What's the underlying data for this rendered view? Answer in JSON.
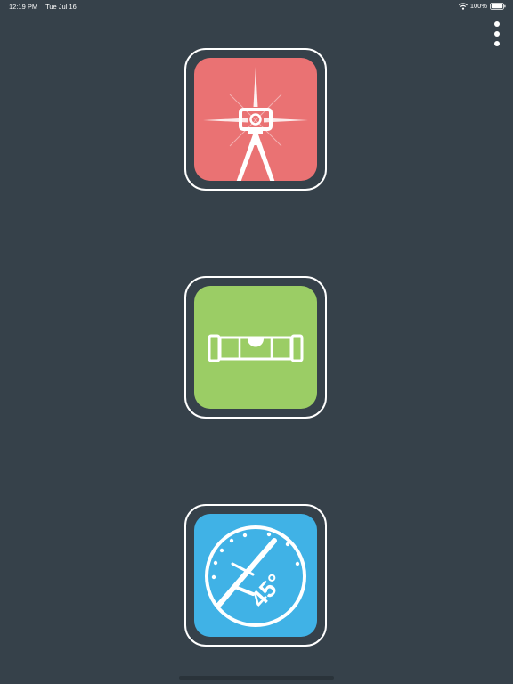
{
  "status_bar": {
    "time": "12:19 PM",
    "date": "Tue Jul 16",
    "wifi_icon": "wifi-icon",
    "battery_percent": "100%",
    "battery_icon": "battery-full-icon"
  },
  "menu": {
    "icon": "more-vertical-icon"
  },
  "tools": [
    {
      "id": "laser-level",
      "icon": "tripod-laser-icon",
      "color": "#ea7273"
    },
    {
      "id": "bubble-level",
      "icon": "bubble-level-icon",
      "color": "#9bcd65"
    },
    {
      "id": "angle-gauge",
      "icon": "protractor-angle-icon",
      "color": "#40b2e6",
      "label": "45°"
    }
  ],
  "colors": {
    "background": "#36414a",
    "button_border": "#ffffff"
  }
}
